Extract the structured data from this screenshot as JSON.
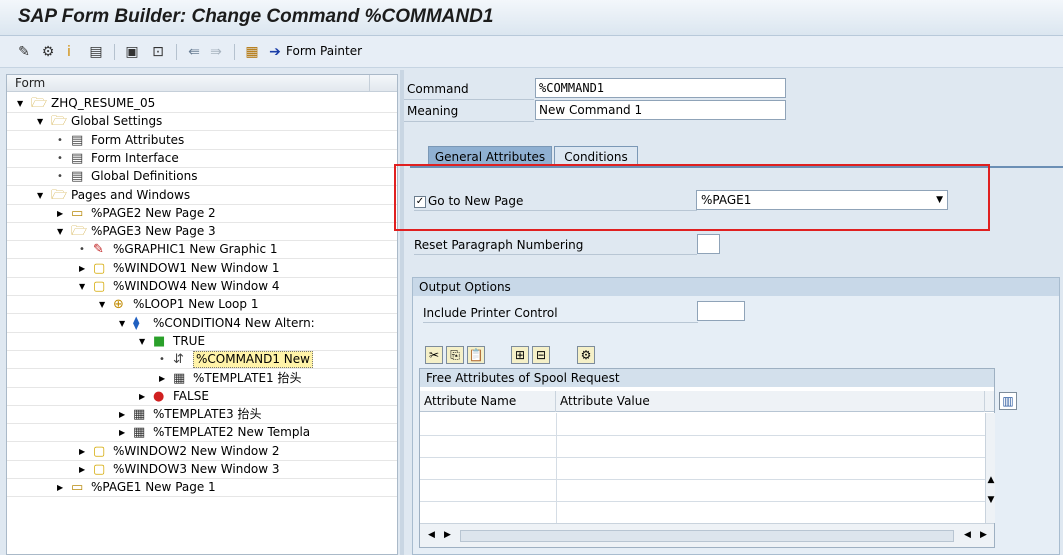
{
  "window": {
    "title": "SAP Form Builder: Change Command %COMMAND1"
  },
  "toolbar": {
    "icons": [
      "edit-icon",
      "activate-icon",
      "info-icon",
      "print-preview-icon",
      "test-icon",
      "layout-icon",
      "back-icon",
      "forward-icon",
      "settings-icon"
    ],
    "form_painter_label": "Form Painter"
  },
  "tree": {
    "header": "Form",
    "nodes": [
      {
        "label": "ZHQ_RESUME_05",
        "icon": "folder-open-icon",
        "expand": "open"
      },
      {
        "label": "Global Settings",
        "icon": "folder-open-icon",
        "expand": "open"
      },
      {
        "label": "Form Attributes",
        "icon": "document-icon",
        "expand": "leaf"
      },
      {
        "label": "Form Interface",
        "icon": "document-icon",
        "expand": "leaf"
      },
      {
        "label": "Global Definitions",
        "icon": "document-icon",
        "expand": "leaf"
      },
      {
        "label": "Pages and Windows",
        "icon": "folder-open-icon",
        "expand": "open"
      },
      {
        "label": "%PAGE2 New Page 2",
        "icon": "folder-icon",
        "expand": "closed"
      },
      {
        "label": "%PAGE3 New Page 3",
        "icon": "folder-open-icon",
        "expand": "open"
      },
      {
        "label": "%GRAPHIC1 New Graphic 1",
        "icon": "graphic-icon",
        "expand": "leaf"
      },
      {
        "label": "%WINDOW1 New Window 1",
        "icon": "window-icon",
        "expand": "closed"
      },
      {
        "label": "%WINDOW4 New Window 4",
        "icon": "window-icon",
        "expand": "open"
      },
      {
        "label": "%LOOP1 New Loop 1",
        "icon": "loop-icon",
        "expand": "open"
      },
      {
        "label": "%CONDITION4 New Altern:",
        "icon": "condition-icon",
        "expand": "open"
      },
      {
        "label": "TRUE",
        "icon": "true-icon",
        "expand": "open"
      },
      {
        "label": "%COMMAND1 New",
        "icon": "command-icon",
        "expand": "leaf"
      },
      {
        "label": "%TEMPLATE1 抬头",
        "icon": "table-icon",
        "expand": "closed"
      },
      {
        "label": "FALSE",
        "icon": "false-icon",
        "expand": "closed"
      },
      {
        "label": "%TEMPLATE3 抬头",
        "icon": "table-icon",
        "expand": "closed"
      },
      {
        "label": "%TEMPLATE2 New Templa",
        "icon": "table-icon",
        "expand": "closed"
      },
      {
        "label": "%WINDOW2 New Window 2",
        "icon": "window-icon",
        "expand": "closed"
      },
      {
        "label": "%WINDOW3 New Window 3",
        "icon": "window-icon",
        "expand": "closed"
      },
      {
        "label": "%PAGE1 New Page 1",
        "icon": "folder-icon",
        "expand": "closed"
      }
    ]
  },
  "form": {
    "command_label": "Command",
    "command_value": "%COMMAND1",
    "meaning_label": "Meaning",
    "meaning_value": "New Command 1"
  },
  "tabs": [
    {
      "label": "General Attributes",
      "active": true
    },
    {
      "label": "Conditions",
      "active": false
    }
  ],
  "general": {
    "goto_label": "Go to New Page",
    "goto_checked": "✓",
    "goto_value": "%PAGE1",
    "reset_label": "Reset Paragraph Numbering",
    "reset_value": ""
  },
  "output_options": {
    "title": "Output Options",
    "printer_control_label": "Include Printer Control",
    "printer_control_value": "",
    "spool_title": "Free Attributes of Spool Request",
    "columns": [
      "Attribute Name",
      "Attribute Value"
    ],
    "rows": [
      [
        "",
        ""
      ],
      [
        "",
        ""
      ],
      [
        "",
        ""
      ],
      [
        "",
        ""
      ]
    ]
  },
  "colors": {
    "highlight": "#e02020",
    "tab_active": "#8fb0d2",
    "background": "#dfe8f1"
  }
}
